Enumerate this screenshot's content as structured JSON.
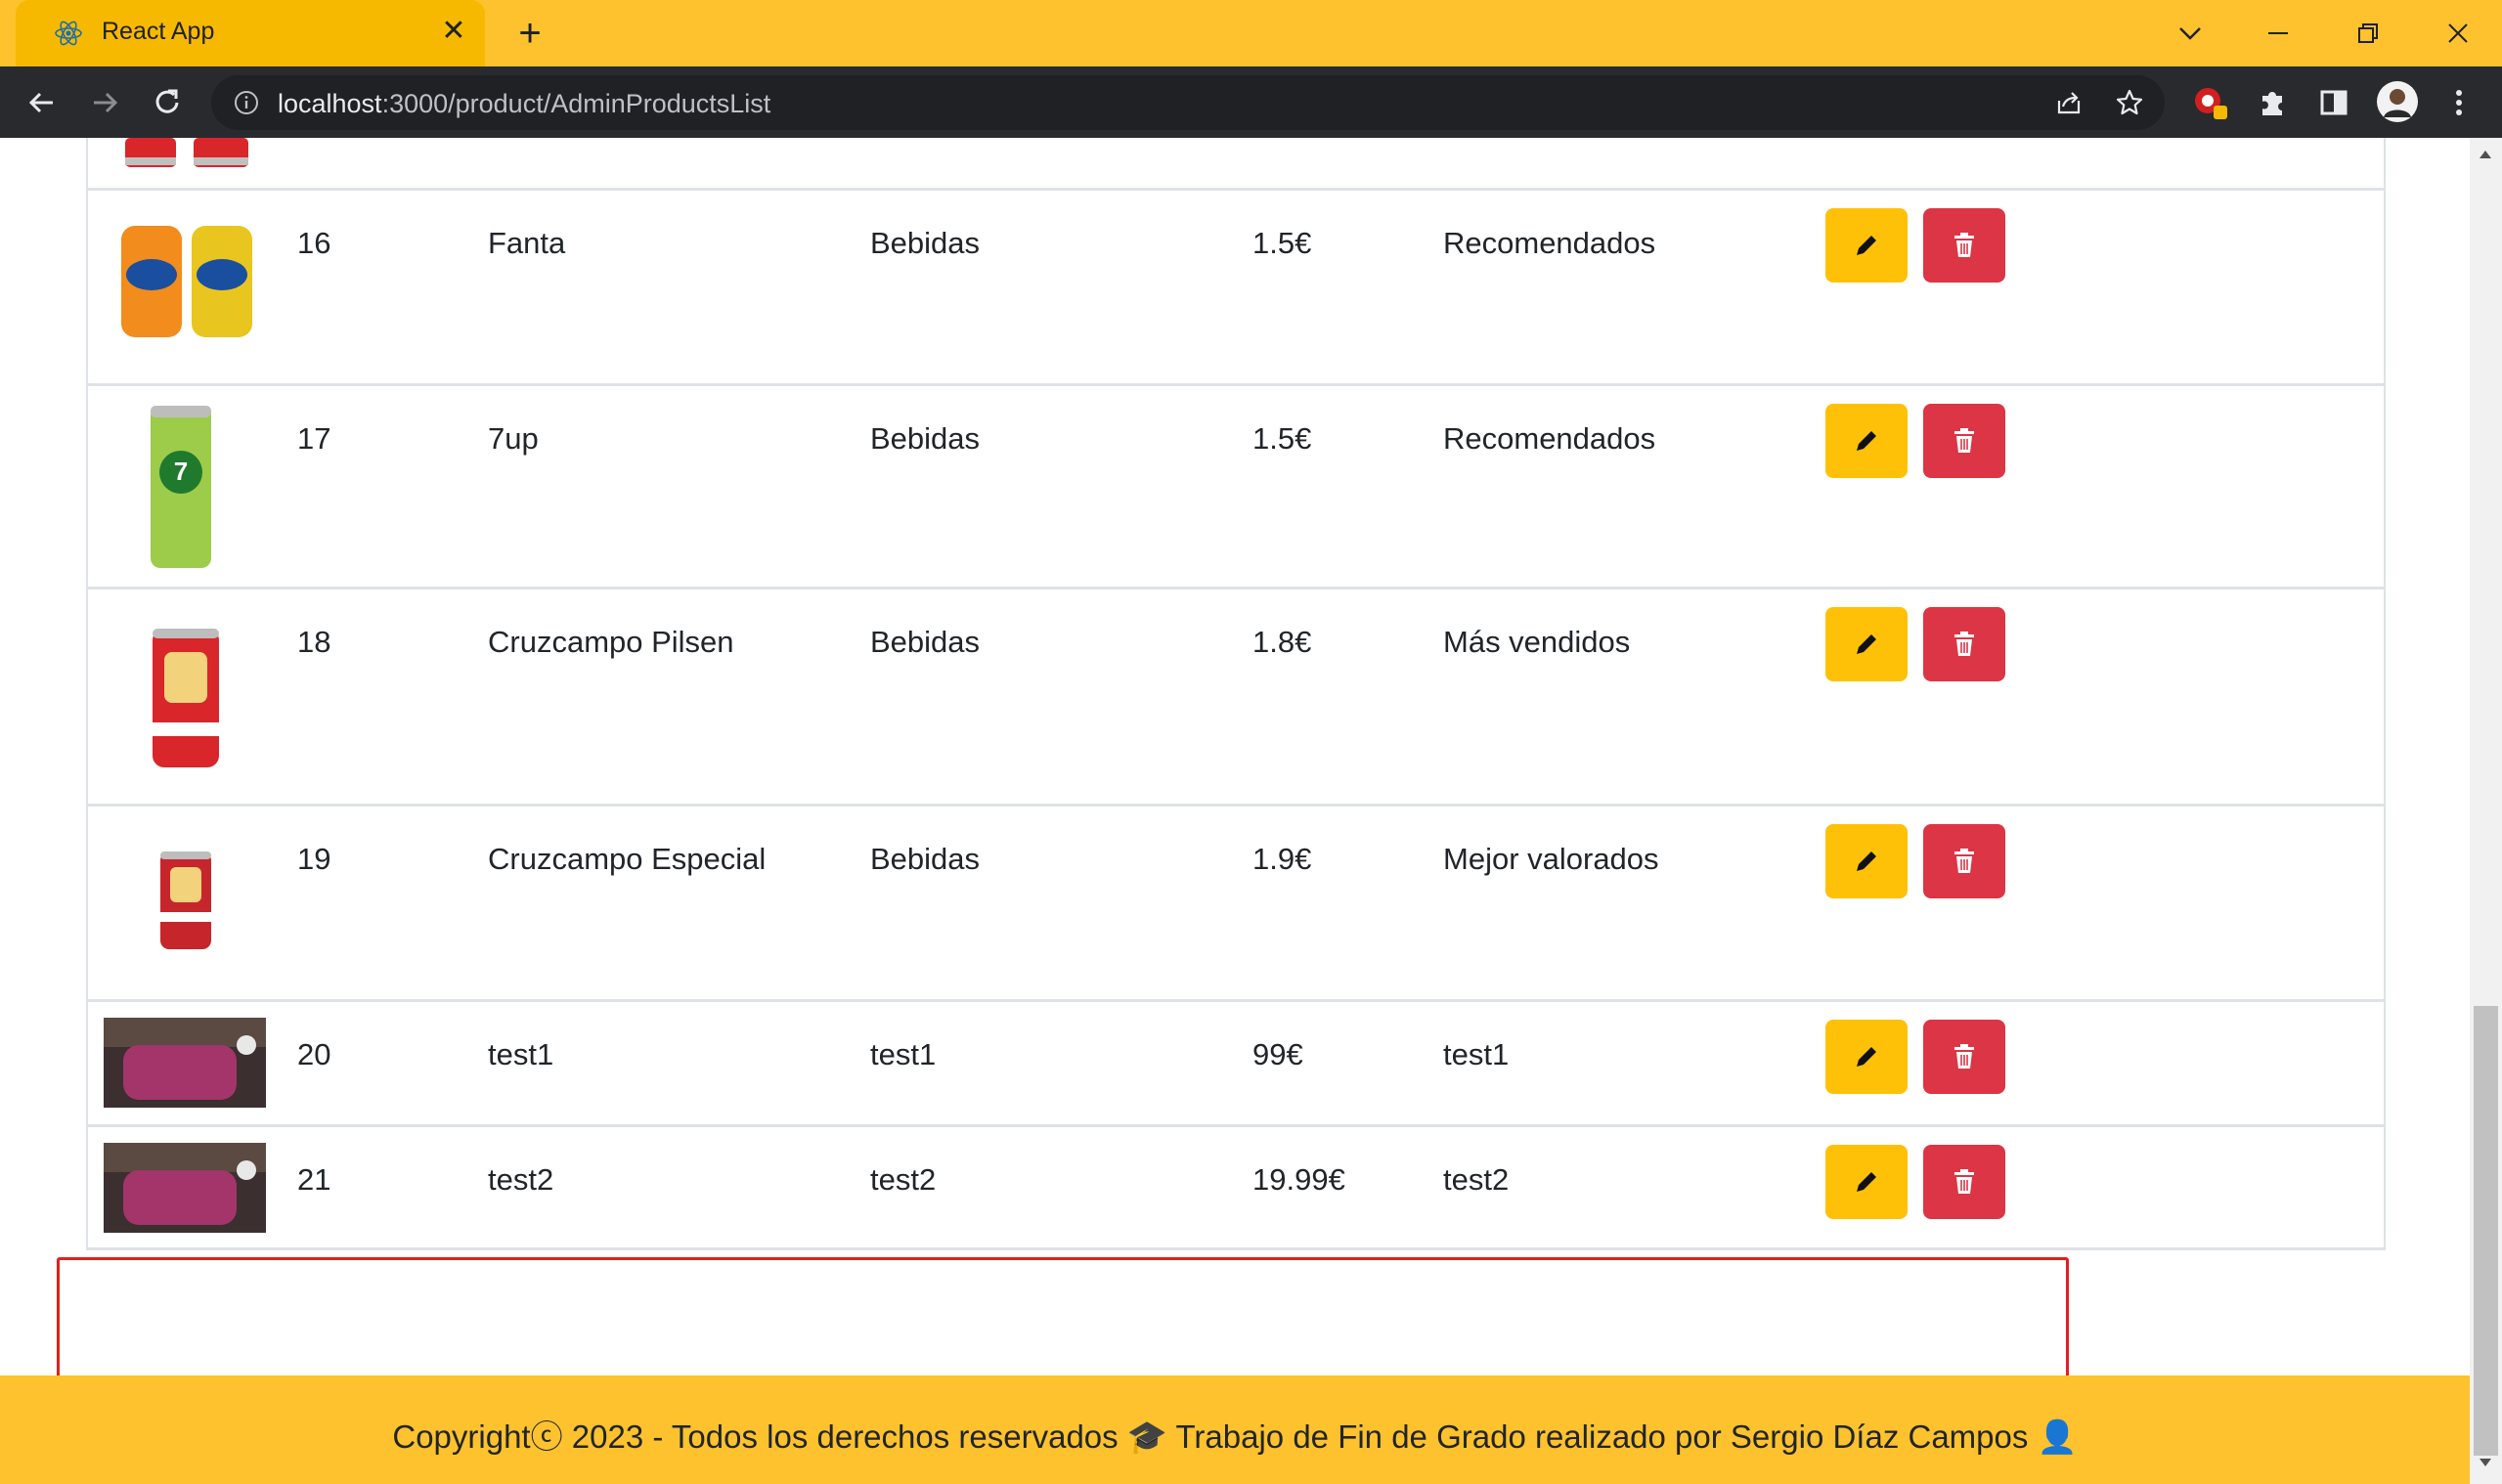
{
  "browser": {
    "tab_title": "React App",
    "tab_close": "✕",
    "new_tab": "+",
    "url_host": "localhost",
    "url_path": ":3000/product/AdminProductsList"
  },
  "colors": {
    "brand_yellow": "#fdc22d",
    "edit_button": "#ffc107",
    "delete_button": "#dc3545",
    "highlight_border": "#e02020"
  },
  "products": [
    {
      "id": "16",
      "name": "Fanta",
      "category": "Bebidas",
      "price": "1.5€",
      "section": "Recomendados",
      "image": "fanta-cans"
    },
    {
      "id": "17",
      "name": "7up",
      "category": "Bebidas",
      "price": "1.5€",
      "section": "Recomendados",
      "image": "7up-can"
    },
    {
      "id": "18",
      "name": "Cruzcampo Pilsen",
      "category": "Bebidas",
      "price": "1.8€",
      "section": "Más vendidos",
      "image": "cruzcampo-pilsen-can"
    },
    {
      "id": "19",
      "name": "Cruzcampo Especial",
      "category": "Bebidas",
      "price": "1.9€",
      "section": "Mejor valorados",
      "image": "cruzcampo-especial-can"
    },
    {
      "id": "20",
      "name": "test1",
      "category": "test1",
      "price": "99€",
      "section": "test1",
      "image": "oido-cocina-logo"
    },
    {
      "id": "21",
      "name": "test2",
      "category": "test2",
      "price": "19.99€",
      "section": "test2",
      "image": "oido-cocina-logo"
    }
  ],
  "footer": {
    "text": "Copyrightⓒ 2023 - Todos los derechos reservados 🎓 Trabajo de Fin de Grado realizado por Sergio Díaz Campos 👤"
  }
}
